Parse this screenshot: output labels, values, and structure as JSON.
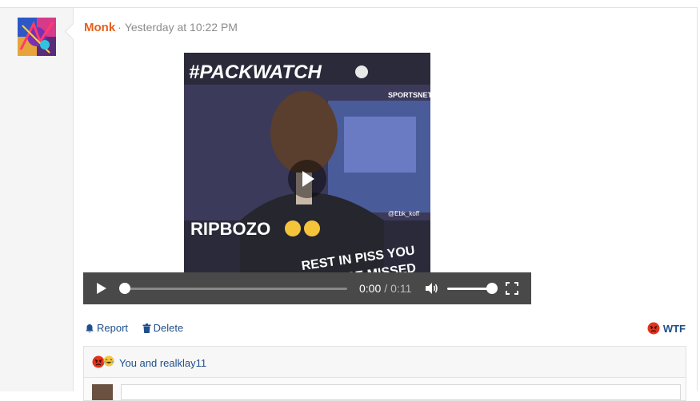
{
  "post": {
    "username": "Monk",
    "separator": "·",
    "timestamp": "Yesterday at 10:22 PM"
  },
  "video": {
    "overlay_top": "#PACKWATCH",
    "overlay_brand": "SPORTSNET",
    "overlay_middle": "RIPBOZO",
    "overlay_bottom_line1": "REST IN PISS YOU",
    "overlay_bottom_line2": "WONT BE MISSED",
    "overlay_watermark": "@Ebk_koff",
    "current_time": "0:00",
    "time_separator": "/",
    "duration": "0:11",
    "progress": 0,
    "volume": 1
  },
  "actions": {
    "report_label": "Report",
    "delete_label": "Delete",
    "reaction_label": "WTF"
  },
  "reactions": {
    "text": "You and realklay11"
  },
  "colors": {
    "username": "#e8601c",
    "link": "#1f4f8b",
    "controls_bg": "#494949"
  }
}
